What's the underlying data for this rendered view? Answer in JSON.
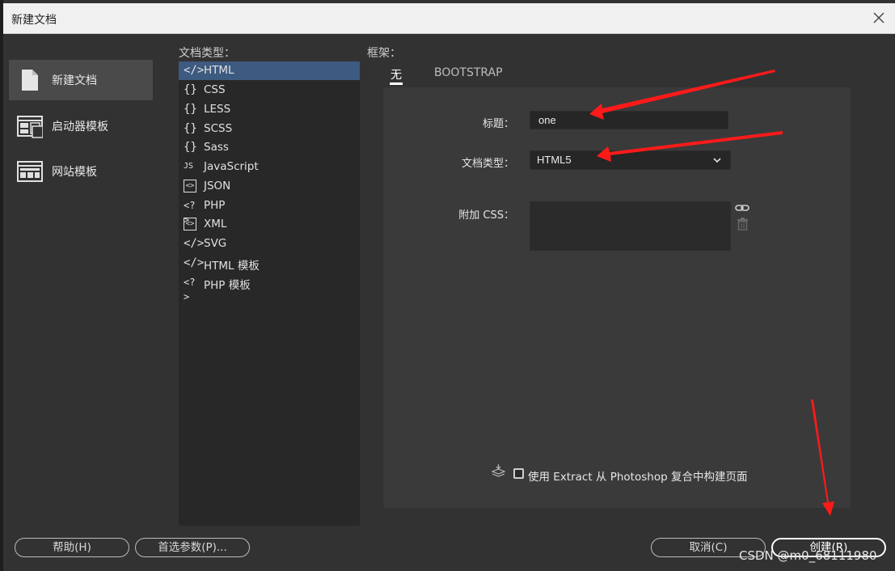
{
  "window": {
    "title": "新建文档"
  },
  "categories": [
    {
      "label": "新建文档",
      "icon": "document-icon",
      "selected": true
    },
    {
      "label": "启动器模板",
      "icon": "starter-template-icon",
      "selected": false
    },
    {
      "label": "网站模板",
      "icon": "site-template-icon",
      "selected": false
    }
  ],
  "doc_types": {
    "header": "文档类型：",
    "items": [
      {
        "icon": "</>",
        "label": "HTML",
        "selected": true
      },
      {
        "icon": "{}",
        "label": "CSS"
      },
      {
        "icon": "{}",
        "label": "LESS"
      },
      {
        "icon": "{}",
        "label": "SCSS"
      },
      {
        "icon": "{}",
        "label": "Sass"
      },
      {
        "icon": "JS",
        "label": "JavaScript"
      },
      {
        "icon": "<>",
        "label": "JSON"
      },
      {
        "icon": "<?>",
        "label": "PHP"
      },
      {
        "icon": "<>",
        "label": "XML"
      },
      {
        "icon": "</>",
        "label": "SVG"
      },
      {
        "icon": "</>",
        "label": "HTML 模板"
      },
      {
        "icon": "<?>",
        "label": "PHP 模板"
      }
    ]
  },
  "framework": {
    "header": "框架：",
    "tabs": [
      {
        "label": "无",
        "active": true
      },
      {
        "label": "BOOTSTRAP",
        "active": false
      }
    ]
  },
  "form": {
    "title_label": "标题：",
    "title_value": "one",
    "doctype_label": "文档类型：",
    "doctype_value": "HTML5",
    "css_label": "附加 CSS："
  },
  "extract": {
    "label": "使用 Extract 从 Photoshop 复合中构建页面",
    "checked": false
  },
  "buttons": {
    "help": "帮助(H)",
    "prefs": "首选参数(P)...",
    "cancel": "取消(C)",
    "create": "创建(R)"
  },
  "watermark": "CSDN @m0_68111980",
  "colors": {
    "accent_selection": "#3d5a80",
    "arrow": "#ff1a1a"
  }
}
